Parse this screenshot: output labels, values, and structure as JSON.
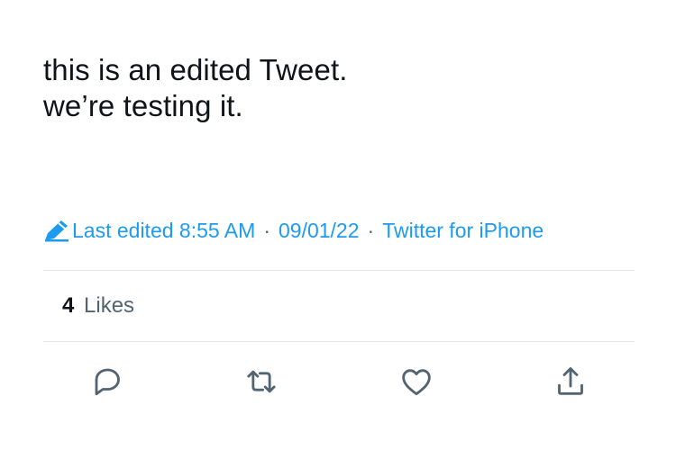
{
  "tweet": {
    "text_lines": [
      "this is an edited Tweet.",
      "we’re testing it."
    ],
    "edited_label": "Last edited 8:55 AM",
    "separator": "·",
    "date": "09/01/22",
    "source": "Twitter for iPhone",
    "likes_count": "4",
    "likes_label": "Likes"
  },
  "actions": {
    "reply_icon": "reply-icon",
    "retweet_icon": "retweet-icon",
    "like_icon": "heart-icon",
    "share_icon": "share-icon"
  },
  "colors": {
    "text": "#0f1419",
    "secondary": "#536471",
    "accent": "#1d9bf0",
    "divider": "#e3e7ea"
  }
}
